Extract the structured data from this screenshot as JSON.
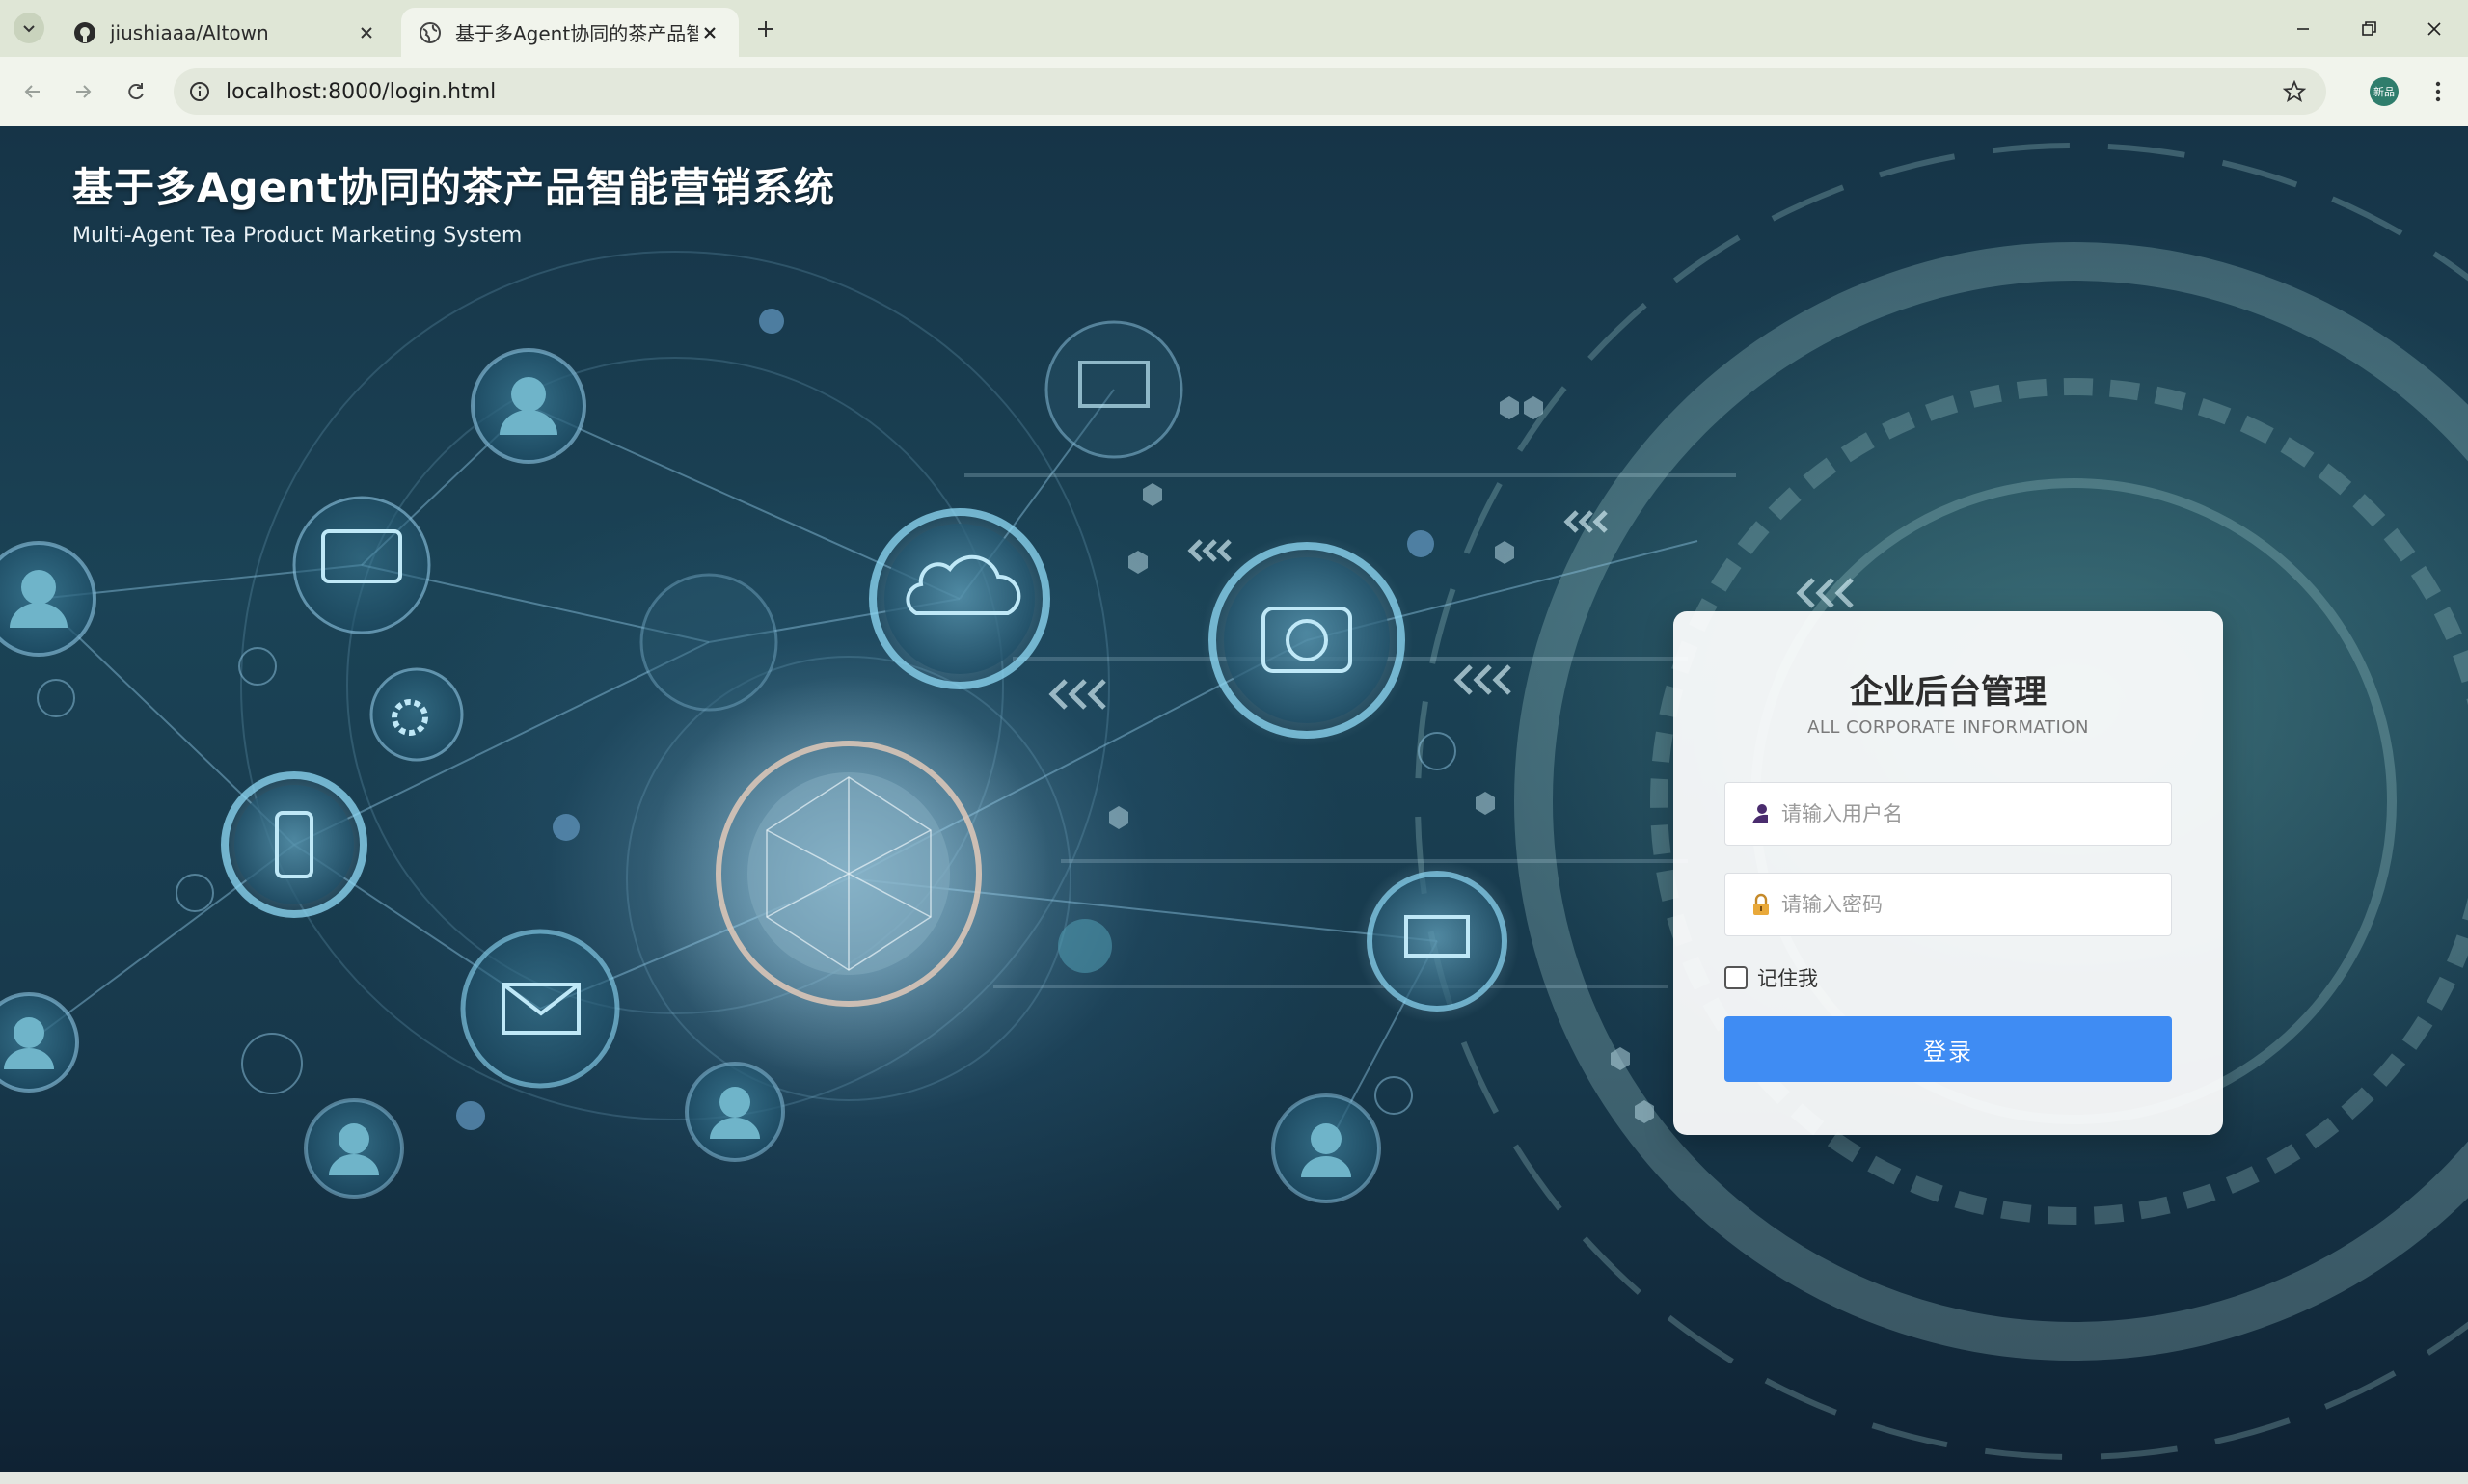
{
  "browser": {
    "tabs": [
      {
        "title": "jiushiaaa/AItown",
        "favicon": "github-icon",
        "active": false
      },
      {
        "title": "基于多Agent协同的茶产品智能",
        "favicon": "globe-icon",
        "active": true
      }
    ],
    "url_host": "localhost",
    "url_rest": ":8000/login.html",
    "profile_label": "新品"
  },
  "header": {
    "title": "基于多Agent协同的茶产品智能营销系统",
    "subtitle": "Multi-Agent Tea Product Marketing System"
  },
  "login": {
    "title": "企业后台管理",
    "subtitle": "ALL CORPORATE INFORMATION",
    "username_placeholder": "请输入用户名",
    "password_placeholder": "请输入密码",
    "remember_label": "记住我",
    "submit_label": "登录"
  },
  "colors": {
    "accent": "#3f8cf3",
    "background": "#17384b"
  }
}
